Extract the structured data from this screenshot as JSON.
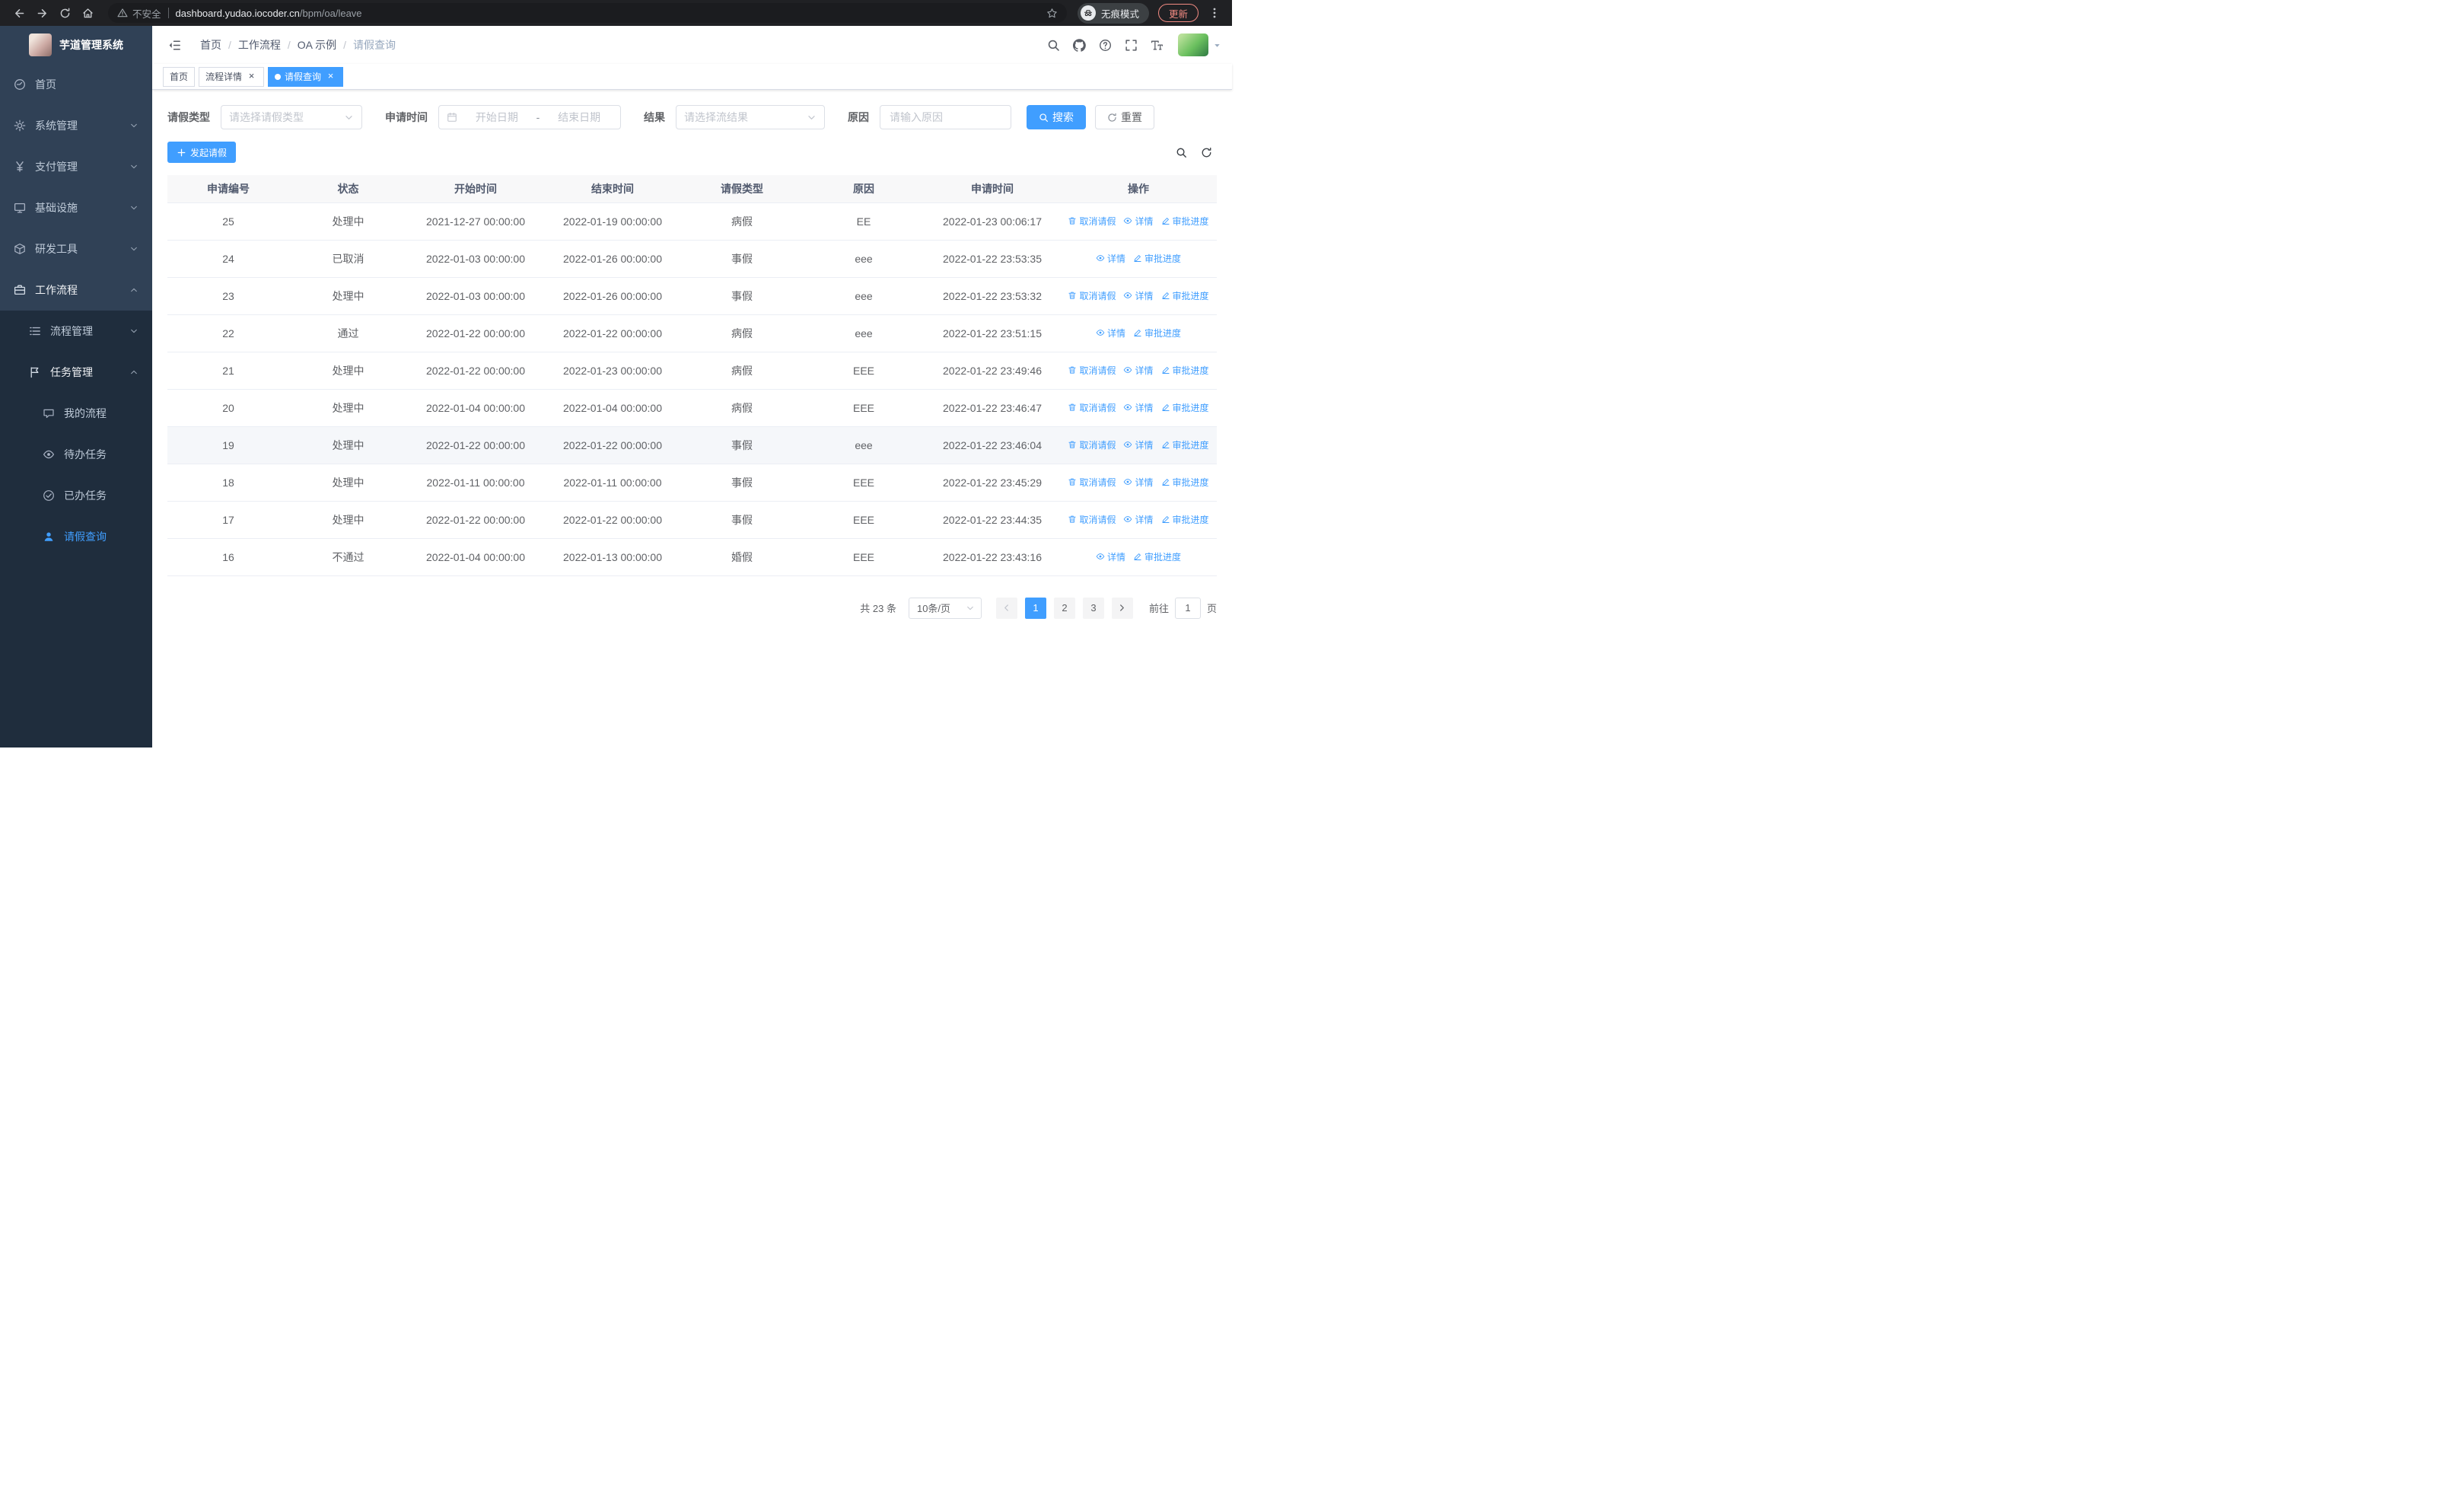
{
  "browser": {
    "security_label": "不安全",
    "url_domain": "dashboard.yudao.iocoder.cn",
    "url_path": "/bpm/oa/leave",
    "incognito_label": "无痕模式",
    "update_label": "更新"
  },
  "sidebar": {
    "app_title": "芋道管理系统",
    "menu": [
      {
        "label": "首页",
        "icon": "dashboard",
        "level": 1,
        "arrow": null
      },
      {
        "label": "系统管理",
        "icon": "gear",
        "level": 1,
        "arrow": "down"
      },
      {
        "label": "支付管理",
        "icon": "yen",
        "level": 1,
        "arrow": "down"
      },
      {
        "label": "基础设施",
        "icon": "monitor",
        "level": 1,
        "arrow": "down"
      },
      {
        "label": "研发工具",
        "icon": "cube",
        "level": 1,
        "arrow": "down"
      },
      {
        "label": "工作流程",
        "icon": "briefcase",
        "level": 1,
        "arrow": "up"
      },
      {
        "label": "流程管理",
        "icon": "list",
        "level": 2,
        "arrow": "down"
      },
      {
        "label": "任务管理",
        "icon": "flag",
        "level": 2,
        "arrow": "up"
      },
      {
        "label": "我的流程",
        "icon": "message",
        "level": 3,
        "arrow": null
      },
      {
        "label": "待办任务",
        "icon": "eye",
        "level": 3,
        "arrow": null
      },
      {
        "label": "已办任务",
        "icon": "check",
        "level": 3,
        "arrow": null
      },
      {
        "label": "请假查询",
        "icon": "user",
        "level": 3,
        "arrow": null,
        "active": true
      }
    ]
  },
  "navbar": {
    "separator": "/",
    "breadcrumb": [
      {
        "label": "首页"
      },
      {
        "label": "工作流程"
      },
      {
        "label": "OA 示例"
      },
      {
        "label": "请假查询",
        "current": true
      }
    ]
  },
  "tabs": [
    {
      "label": "首页",
      "closable": false,
      "active": false
    },
    {
      "label": "流程详情",
      "closable": true,
      "active": false
    },
    {
      "label": "请假查询",
      "closable": true,
      "active": true
    }
  ],
  "filters": {
    "leave_type": {
      "label": "请假类型",
      "placeholder": "请选择请假类型"
    },
    "apply_time": {
      "label": "申请时间",
      "start_placeholder": "开始日期",
      "separator": "-",
      "end_placeholder": "结束日期"
    },
    "result": {
      "label": "结果",
      "placeholder": "请选择流结果"
    },
    "reason": {
      "label": "原因",
      "placeholder": "请输入原因"
    },
    "search_label": "搜索",
    "reset_label": "重置"
  },
  "toolbar": {
    "create_label": "发起请假"
  },
  "table": {
    "headers": [
      "申请编号",
      "状态",
      "开始时间",
      "结束时间",
      "请假类型",
      "原因",
      "申请时间",
      "操作"
    ],
    "actions": {
      "cancel": {
        "label": "取消请假",
        "icon": "delete"
      },
      "detail": {
        "label": "详情",
        "icon": "eye"
      },
      "progress": {
        "label": "审批进度",
        "icon": "edit"
      }
    },
    "rows": [
      {
        "id": "25",
        "status": "处理中",
        "start": "2021-12-27 00:00:00",
        "end": "2022-01-19 00:00:00",
        "type": "病假",
        "reason": "EE",
        "apply_time": "2022-01-23 00:06:17",
        "actions": [
          "cancel",
          "detail",
          "progress"
        ]
      },
      {
        "id": "24",
        "status": "已取消",
        "start": "2022-01-03 00:00:00",
        "end": "2022-01-26 00:00:00",
        "type": "事假",
        "reason": "eee",
        "apply_time": "2022-01-22 23:53:35",
        "actions": [
          "detail",
          "progress"
        ]
      },
      {
        "id": "23",
        "status": "处理中",
        "start": "2022-01-03 00:00:00",
        "end": "2022-01-26 00:00:00",
        "type": "事假",
        "reason": "eee",
        "apply_time": "2022-01-22 23:53:32",
        "actions": [
          "cancel",
          "detail",
          "progress"
        ]
      },
      {
        "id": "22",
        "status": "通过",
        "start": "2022-01-22 00:00:00",
        "end": "2022-01-22 00:00:00",
        "type": "病假",
        "reason": "eee",
        "apply_time": "2022-01-22 23:51:15",
        "actions": [
          "detail",
          "progress"
        ]
      },
      {
        "id": "21",
        "status": "处理中",
        "start": "2022-01-22 00:00:00",
        "end": "2022-01-23 00:00:00",
        "type": "病假",
        "reason": "EEE",
        "apply_time": "2022-01-22 23:49:46",
        "actions": [
          "cancel",
          "detail",
          "progress"
        ]
      },
      {
        "id": "20",
        "status": "处理中",
        "start": "2022-01-04 00:00:00",
        "end": "2022-01-04 00:00:00",
        "type": "病假",
        "reason": "EEE",
        "apply_time": "2022-01-22 23:46:47",
        "actions": [
          "cancel",
          "detail",
          "progress"
        ]
      },
      {
        "id": "19",
        "status": "处理中",
        "start": "2022-01-22 00:00:00",
        "end": "2022-01-22 00:00:00",
        "type": "事假",
        "reason": "eee",
        "apply_time": "2022-01-22 23:46:04",
        "actions": [
          "cancel",
          "detail",
          "progress"
        ],
        "highlighted": true
      },
      {
        "id": "18",
        "status": "处理中",
        "start": "2022-01-11 00:00:00",
        "end": "2022-01-11 00:00:00",
        "type": "事假",
        "reason": "EEE",
        "apply_time": "2022-01-22 23:45:29",
        "actions": [
          "cancel",
          "detail",
          "progress"
        ]
      },
      {
        "id": "17",
        "status": "处理中",
        "start": "2022-01-22 00:00:00",
        "end": "2022-01-22 00:00:00",
        "type": "事假",
        "reason": "EEE",
        "apply_time": "2022-01-22 23:44:35",
        "actions": [
          "cancel",
          "detail",
          "progress"
        ]
      },
      {
        "id": "16",
        "status": "不通过",
        "start": "2022-01-04 00:00:00",
        "end": "2022-01-13 00:00:00",
        "type": "婚假",
        "reason": "EEE",
        "apply_time": "2022-01-22 23:43:16",
        "actions": [
          "detail",
          "progress"
        ]
      }
    ]
  },
  "pagination": {
    "total_label": "共 23 条",
    "page_size_label": "10条/页",
    "pages": [
      "1",
      "2",
      "3"
    ],
    "active_page": "1",
    "goto_label": "前往",
    "goto_value": "1",
    "unit_label": "页"
  },
  "colors": {
    "primary": "#409eff",
    "sidebar_bg": "#304156",
    "submenu_bg": "#1f2d3d"
  }
}
